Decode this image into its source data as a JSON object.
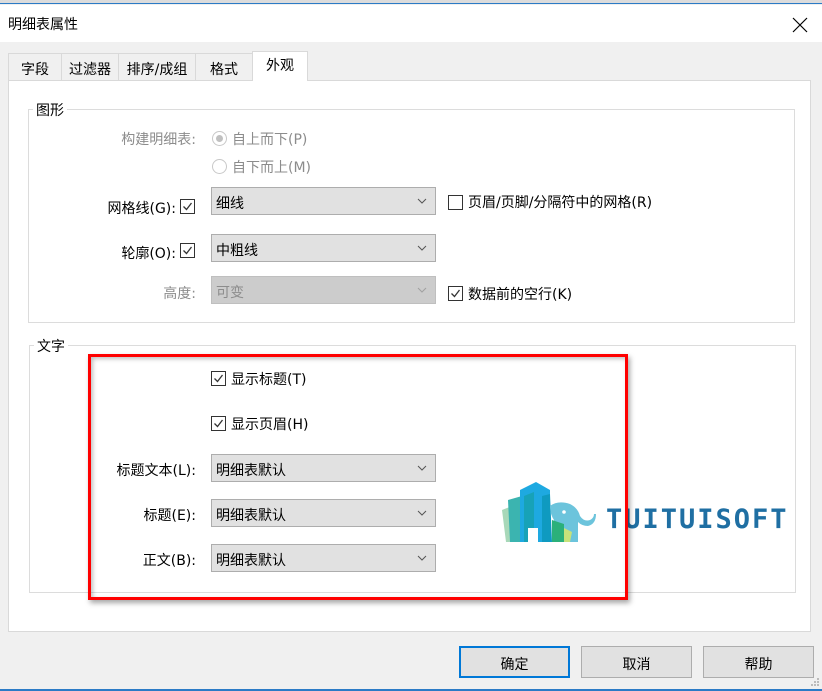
{
  "window": {
    "title": "明细表属性",
    "close_icon": "close-icon"
  },
  "tabs": [
    {
      "label": "字段",
      "active": false
    },
    {
      "label": "过滤器",
      "active": false
    },
    {
      "label": "排序/成组",
      "active": false
    },
    {
      "label": "格式",
      "active": false
    },
    {
      "label": "外观",
      "active": true
    }
  ],
  "graphics": {
    "title": "图形",
    "build_label": "构建明细表:",
    "build_options": [
      {
        "label": "自上而下(P)",
        "selected": true,
        "enabled": false
      },
      {
        "label": "自下而上(M)",
        "selected": false,
        "enabled": false
      }
    ],
    "gridlines": {
      "label": "网格线(G):",
      "checked": true,
      "value": "细线"
    },
    "header_footer_grid": {
      "label": "页眉/页脚/分隔符中的网格(R)",
      "checked": false
    },
    "outline": {
      "label": "轮廓(O):",
      "checked": true,
      "value": "中粗线"
    },
    "height": {
      "label": "高度:",
      "value": "可变",
      "enabled": false
    },
    "blank_row": {
      "label": "数据前的空行(K)",
      "checked": true
    }
  },
  "text": {
    "title": "文字",
    "show_title": {
      "label": "显示标题(T)",
      "checked": true
    },
    "show_header": {
      "label": "显示页眉(H)",
      "checked": true
    },
    "title_text": {
      "label": "标题文本(L):",
      "value": "明细表默认"
    },
    "header": {
      "label": "标题(E):",
      "value": "明细表默认"
    },
    "body": {
      "label": "正文(B):",
      "value": "明细表默认"
    }
  },
  "watermark": {
    "text": "TUITUISOFT"
  },
  "buttons": {
    "ok": "确定",
    "cancel": "取消",
    "help": "帮助"
  },
  "colors": {
    "accent": "#0078d7",
    "highlight_box": "#ff0000",
    "logo_text": "#1f6fa3"
  }
}
